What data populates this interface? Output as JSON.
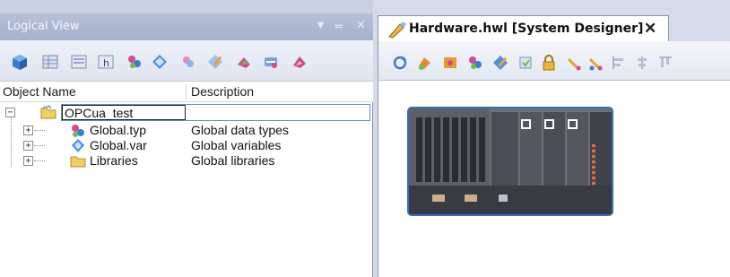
{
  "logical_view": {
    "title": "Logical View",
    "controls": {
      "dropdown": "▼",
      "pin": "ᚚ",
      "close": "✕"
    },
    "toolbar": [
      "open-project",
      "window-grid",
      "explorer",
      "help",
      "data-types",
      "variables",
      "add-datatype",
      "edit",
      "compile",
      "transfer",
      "diagnose"
    ],
    "columns": {
      "name": "Object Name",
      "description": "Description"
    },
    "tree": {
      "root": {
        "label": "OPCua_test",
        "expander": "−"
      },
      "children": [
        {
          "label": "Global.typ",
          "description": "Global data types",
          "expander": "+"
        },
        {
          "label": "Global.var",
          "description": "Global variables",
          "expander": "+"
        },
        {
          "label": "Libraries",
          "description": "Global libraries",
          "expander": "+"
        }
      ]
    }
  },
  "editor": {
    "tab": {
      "title": "Hardware.hwl [System Designer]",
      "close": "✕"
    },
    "toolbar": [
      "refresh",
      "insert",
      "paint",
      "data-types",
      "edit",
      "compile",
      "lock",
      "comment",
      "tools",
      "align-left",
      "align-center",
      "align-top"
    ]
  },
  "colors": {
    "pane_title_bg": "#a8b4cf",
    "tree_selection_border": "#5b8fd1",
    "device_selection": "#3a6bbf",
    "device_body": "#6c6f78"
  }
}
